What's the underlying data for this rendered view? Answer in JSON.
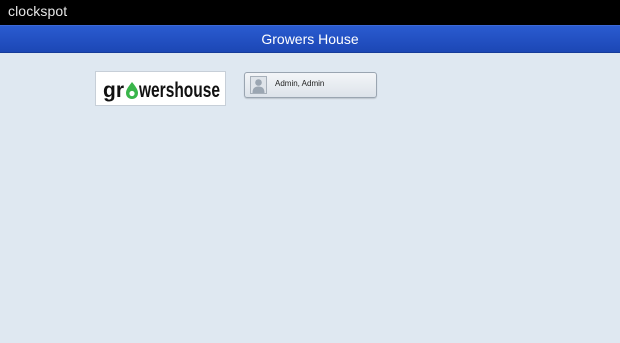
{
  "app": {
    "brand": "clockspot",
    "title": "Growers House"
  },
  "logo": {
    "text": "growershouse",
    "accent_color": "#39b54a"
  },
  "user": {
    "label": "Admin, Admin",
    "icon": "user-avatar-icon"
  },
  "colors": {
    "topbar": "#000000",
    "titlebar": "#2151c4",
    "background": "#dfe8f1"
  }
}
